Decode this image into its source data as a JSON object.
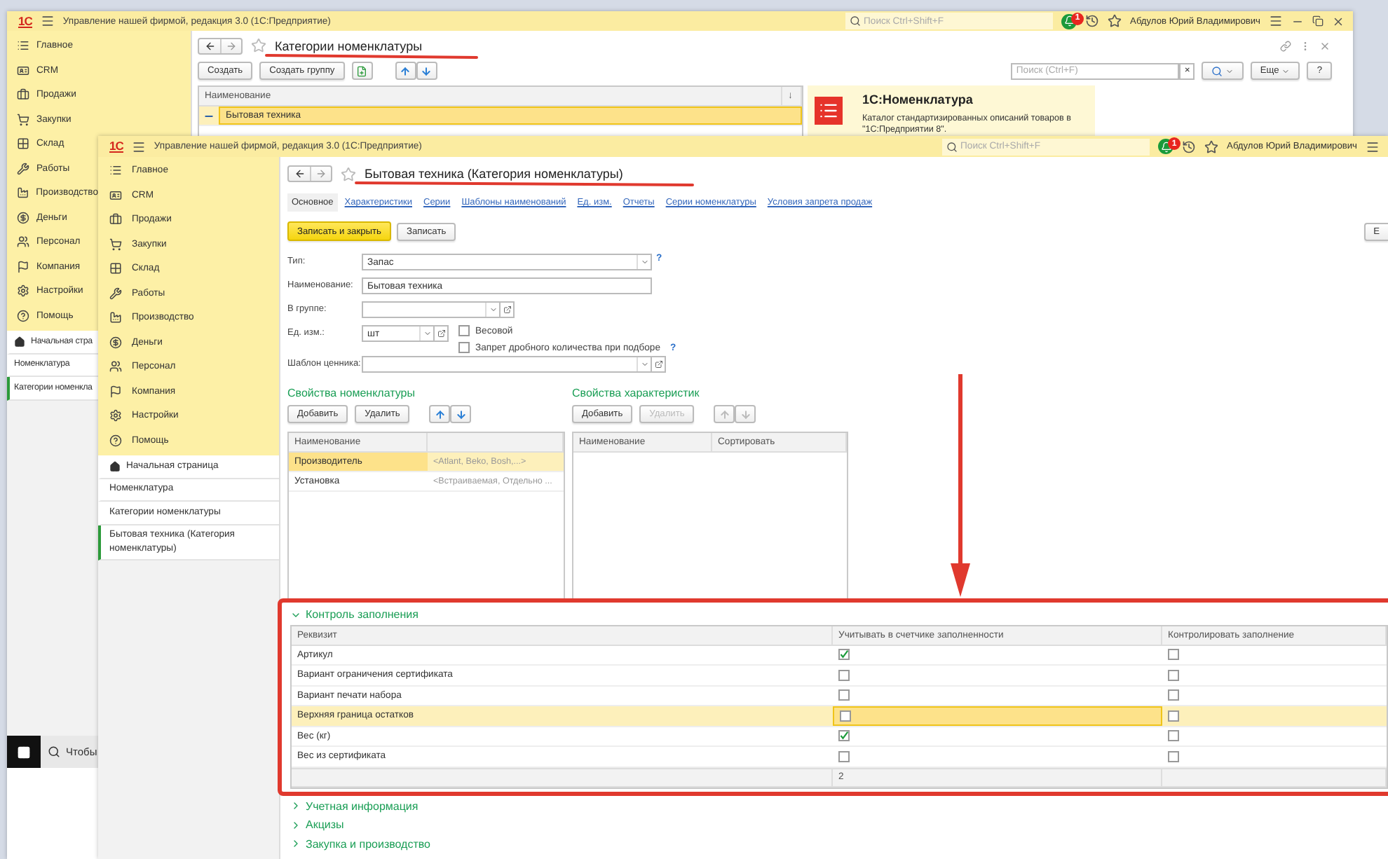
{
  "back_window": {
    "logo": "1С",
    "title": "Управление нашей фирмой, редакция 3.0  (1С:Предприятие)",
    "search_placeholder": "Поиск Ctrl+Shift+F",
    "notifications": "1",
    "user": "Абдулов Юрий Владимирович",
    "sections": [
      "Главное",
      "CRM",
      "Продажи",
      "Закупки",
      "Склад",
      "Работы",
      "Производство",
      "Деньги",
      "Персонал",
      "Компания",
      "Настройки",
      "Помощь"
    ],
    "open_pages": [
      {
        "label": "Начальная стра",
        "kind": "home",
        "selected": false
      },
      {
        "label": "Номенклатура",
        "kind": "page",
        "selected": false
      },
      {
        "label": "Категории номенкла",
        "kind": "page",
        "selected": true
      }
    ],
    "page": {
      "title": "Категории номенклатуры",
      "actions": [
        "Создать",
        "Создать группу"
      ],
      "search_placeholder": "Поиск (Ctrl+F)",
      "clear": "×",
      "more": "Еще",
      "help": "?",
      "columns": [
        "Наименование"
      ],
      "sort_mark": "↓",
      "rows": [
        {
          "name": "Бытовая техника",
          "selected": true
        }
      ],
      "info": {
        "title": "1С:Номенклатура",
        "text": "Каталог стандартизированных описаний товаров в \"1С:Предприятии 8\"."
      }
    }
  },
  "front_window": {
    "logo": "1С",
    "title": "Управление нашей фирмой, редакция 3.0  (1С:Предприятие)",
    "search_placeholder": "Поиск Ctrl+Shift+F",
    "notifications": "1",
    "user": "Абдулов Юрий Владимирович",
    "sections": [
      "Главное",
      "CRM",
      "Продажи",
      "Закупки",
      "Склад",
      "Работы",
      "Производство",
      "Деньги",
      "Персонал",
      "Компания",
      "Настройки",
      "Помощь"
    ],
    "open_pages": [
      {
        "label": "Начальная страница",
        "kind": "home",
        "selected": false
      },
      {
        "label": "Номенклатура",
        "kind": "page",
        "selected": false
      },
      {
        "label": "Категории номенклатуры",
        "kind": "page",
        "selected": false
      },
      {
        "label": "Бытовая техника (Категория номенклатуры)",
        "kind": "page",
        "selected": true
      }
    ],
    "page": {
      "title": "Бытовая техника (Категория номенклатуры)",
      "tabs": [
        {
          "label": "Основное",
          "selected": true
        },
        {
          "label": "Характеристики",
          "selected": false
        },
        {
          "label": "Серии",
          "selected": false
        },
        {
          "label": "Шаблоны наименований",
          "selected": false
        },
        {
          "label": "Ед. изм.",
          "selected": false
        },
        {
          "label": "Отчеты",
          "selected": false
        },
        {
          "label": "Серии номенклатуры",
          "selected": false
        },
        {
          "label": "Условия запрета продаж",
          "selected": false
        }
      ],
      "primary_action": "Записать и закрыть",
      "secondary_action": "Записать",
      "more": "Е",
      "form": [
        {
          "label": "Тип:",
          "value": "Запас",
          "kind": "select",
          "help": "?"
        },
        {
          "label": "Наименование:",
          "value": "Бытовая техника",
          "kind": "text"
        },
        {
          "label": "В группе:",
          "kind": "lookup"
        },
        {
          "label": "Ед. изм.:",
          "value": "шт",
          "kind": "lookup",
          "options": [
            {
              "label": "Весовой",
              "checked": false
            },
            {
              "label": "Запрет дробного количества при подборе",
              "checked": false,
              "help": "?"
            }
          ]
        },
        {
          "label": "Шаблон ценника:",
          "kind": "lookup"
        }
      ],
      "properties": {
        "title": "Свойства номенклатуры",
        "buttons": [
          {
            "label": "Добавить",
            "disabled": false
          },
          {
            "label": "Удалить",
            "disabled": false
          }
        ],
        "arrows_disabled": false,
        "columns": [
          "Наименование"
        ],
        "rows": [
          {
            "name": "Производитель",
            "values": "<Atlant, Beko, Bosh,...>",
            "selected": true
          },
          {
            "name": "Установка",
            "values": "<Встраиваемая, Отдельно ...",
            "selected": false
          }
        ]
      },
      "characteristic_properties": {
        "title": "Свойства характеристик",
        "buttons": [
          {
            "label": "Добавить",
            "disabled": false
          },
          {
            "label": "Удалить",
            "disabled": true
          }
        ],
        "arrows_disabled": true,
        "columns": [
          "Наименование",
          "Сортировать"
        ]
      },
      "fill_control": {
        "title": "Контроль заполнения",
        "expanded": true,
        "columns": [
          "Реквизит",
          "Учитывать в счетчике заполненности",
          "Контролировать заполнение"
        ],
        "rows": [
          {
            "name": "Артикул",
            "count": true,
            "control": false,
            "selected": false
          },
          {
            "name": "Вариант ограничения сертификата",
            "count": false,
            "control": false,
            "selected": false
          },
          {
            "name": "Вариант печати набора",
            "count": false,
            "control": false,
            "selected": false
          },
          {
            "name": "Верхняя граница остатков",
            "count": false,
            "control": false,
            "selected": true
          },
          {
            "name": "Вес (кг)",
            "count": true,
            "control": false,
            "selected": false
          },
          {
            "name": "Вес из сертификата",
            "count": false,
            "control": false,
            "selected": false
          }
        ],
        "total": "2"
      },
      "groups": [
        {
          "title": "Учетная информация",
          "expanded": false
        },
        {
          "title": "Акцизы",
          "expanded": false
        },
        {
          "title": "Закупка и производство",
          "expanded": false
        }
      ]
    }
  },
  "taskbar": {
    "search": "Чтобы"
  }
}
